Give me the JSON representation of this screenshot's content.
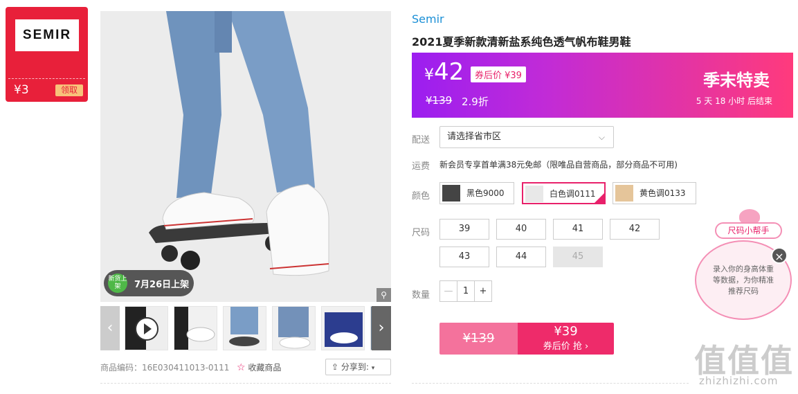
{
  "brand_card": {
    "logo": "SEMIR",
    "coupon": "¥3",
    "get": "领取"
  },
  "gallery": {
    "new_badge": {
      "icon_text": "新货上架",
      "date": "7月26日上架"
    },
    "product_code": "商品编码：16E030411013-0111",
    "favorite": "收藏商品",
    "share": "分享到:"
  },
  "product": {
    "brand": "Semir",
    "title": "2021夏季新款清新盐系纯色透气帆布鞋男鞋"
  },
  "price": {
    "current": "42",
    "currency": "¥",
    "after_coupon": "券后价 ¥39",
    "original": "¥139",
    "discount": "2.9折",
    "promo": "季末特卖",
    "countdown": "5  天 18  小时 后结束"
  },
  "delivery": {
    "label": "配送",
    "placeholder": "请选择省市区"
  },
  "shipping": {
    "label": "运费",
    "text": "新会员专享首单满38元免邮（限唯品自营商品，部分商品不可用)"
  },
  "colors": {
    "label": "颜色",
    "options": [
      {
        "name": "黑色9000",
        "selected": false
      },
      {
        "name": "白色调0111",
        "selected": true
      },
      {
        "name": "黄色调0133",
        "selected": false
      }
    ]
  },
  "sizes": {
    "label": "尺码",
    "options": [
      "39",
      "40",
      "41",
      "42",
      "43",
      "44",
      "45"
    ],
    "disabled": [
      "45"
    ]
  },
  "quantity": {
    "label": "数量",
    "minus": "—",
    "value": "1",
    "plus": "+"
  },
  "buy": {
    "old": "¥139",
    "price": "¥39",
    "action": "券后价 抢 ›"
  },
  "size_helper": {
    "title": "尺码小帮手",
    "text": "录入你的身高体重等数据，为你精准推荐尺码"
  },
  "watermark": {
    "main": "值值值",
    "domain": "zhizhizhi.com"
  }
}
